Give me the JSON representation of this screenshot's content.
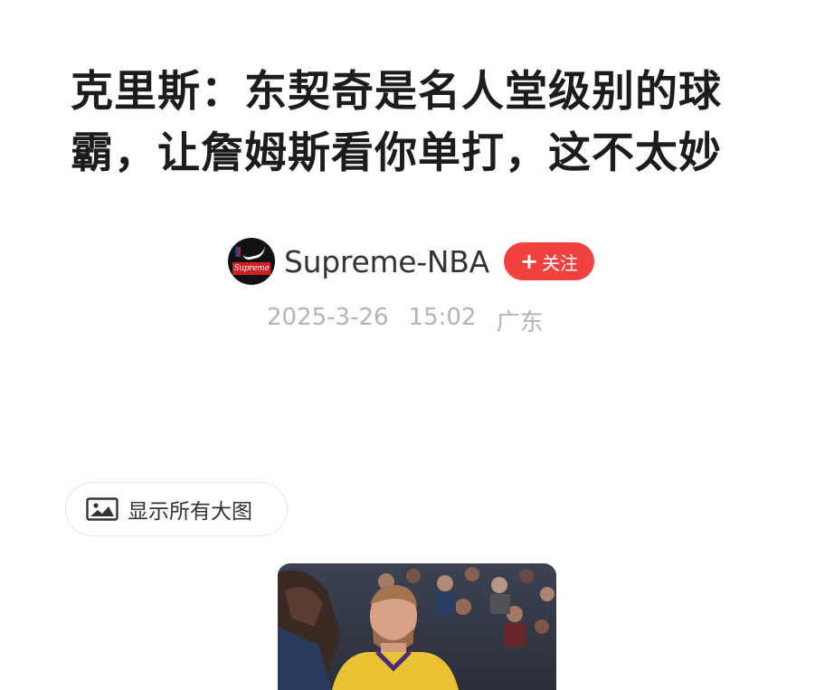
{
  "article": {
    "title": "克里斯：东契奇是名人堂级别的球霸，让詹姆斯看你单打，这不太妙"
  },
  "author": {
    "name": "Supreme-NBA",
    "avatar_text": "Supreme",
    "avatar_icon": "supreme-nike-avatar",
    "follow_label": "关注",
    "follow_icon": "plus-icon",
    "follow_color": "#f2423f"
  },
  "meta": {
    "date": "2025-3-26",
    "time": "15:02",
    "location": "广东"
  },
  "show_images": {
    "label": "显示所有大图",
    "icon": "image-icon"
  },
  "colors": {
    "meta_text": "#b4b4b4",
    "title_text": "#1c1c1c"
  }
}
